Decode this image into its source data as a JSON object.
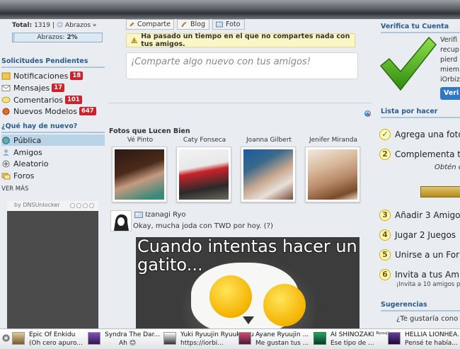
{
  "stats": {
    "total_label": "Total:",
    "total_value": "1319",
    "separator": "|",
    "abrazos_link": "Abrazos »",
    "progress_label": "Abrazos:",
    "progress_value": "2%",
    "progress_fraction": 0.02
  },
  "pending": {
    "title": "Solicitudes Pendientes",
    "items": [
      {
        "label": "Notificaciones",
        "count": "18"
      },
      {
        "label": "Mensajes",
        "count": "17"
      },
      {
        "label": "Comentarios",
        "count": "101"
      },
      {
        "label": "Nuevos Modelos",
        "count": "647"
      }
    ]
  },
  "whats_new": {
    "title": "¿Qué hay de nuevo?",
    "items": [
      {
        "label": "Pública",
        "active": true
      },
      {
        "label": "Amigos",
        "active": false
      },
      {
        "label": "Aleatorio",
        "active": false
      },
      {
        "label": "Foros",
        "active": false
      }
    ],
    "ver_mas": "VER MÁS"
  },
  "ad": {
    "label": "by DNSUnlocker"
  },
  "share": {
    "buttons": [
      "Comparte",
      "Blog",
      "Foto"
    ],
    "warning": "Ha pasado un tiempo en el que no compartes nada con tus amigos.",
    "placeholder": "¡Comparte algo nuevo con tus amigos!"
  },
  "photos": {
    "title": "Fotos que Lucen Bien",
    "people": [
      "Vé Pinto",
      "Caty Fonseca",
      "Joanna Gilbert",
      "Jenifer Miranda"
    ]
  },
  "post": {
    "author": "Izanagi Ryo",
    "text": "Okay, mucha joda con TWD por hoy. (?)",
    "image_caption": "Cuando intentas hacer un\ngatito..."
  },
  "verify": {
    "title": "Verifica tu Cuenta",
    "lines": [
      "Verifi",
      "recup",
      "pierd",
      "miem",
      "iOrbiz"
    ],
    "button": "Veri"
  },
  "todo": {
    "title": "Lista por hacer",
    "items": [
      {
        "num": "✓",
        "label": "Agrega una foto"
      },
      {
        "num": "2",
        "label": "Complementa t"
      },
      {
        "num": "3",
        "label": "Añadir 3 Amigo"
      },
      {
        "num": "4",
        "label": "Jugar 2 Juegos"
      },
      {
        "num": "5",
        "label": "Unirse a un For"
      },
      {
        "num": "6",
        "label": "Invita a tus Am"
      }
    ],
    "sub_2": "Obtén el 10",
    "sub_6": "¡Invita a 10 amigos p"
  },
  "suggestions": {
    "title": "Sugerencias",
    "text": "¿Te gustaría cono"
  },
  "chats": [
    {
      "name": "Epic Of Enkidu",
      "msg": "(Oh cero apuro..."
    },
    {
      "name": "Syndra The Dar...",
      "msg": "Ah 😊"
    },
    {
      "name": "Yuki Ryuujin Ryuuketsu",
      "msg": "https://iorbi..."
    },
    {
      "name": "Ayane Ryuujin ...",
      "msg": "Me gustan tus ..."
    },
    {
      "name": "AI SHINOZAKI ᴿʸᵘᵘʲⁱⁿ",
      "msg": "Ese tipo de ..."
    },
    {
      "name": "HELLIA LIONHEA...",
      "msg": "Pensé te había..."
    }
  ],
  "colors": {
    "accent": "#2a5c8f",
    "badge": "#d0202a",
    "active": "#b8d4e6",
    "verify_button": "#2f78c8"
  }
}
